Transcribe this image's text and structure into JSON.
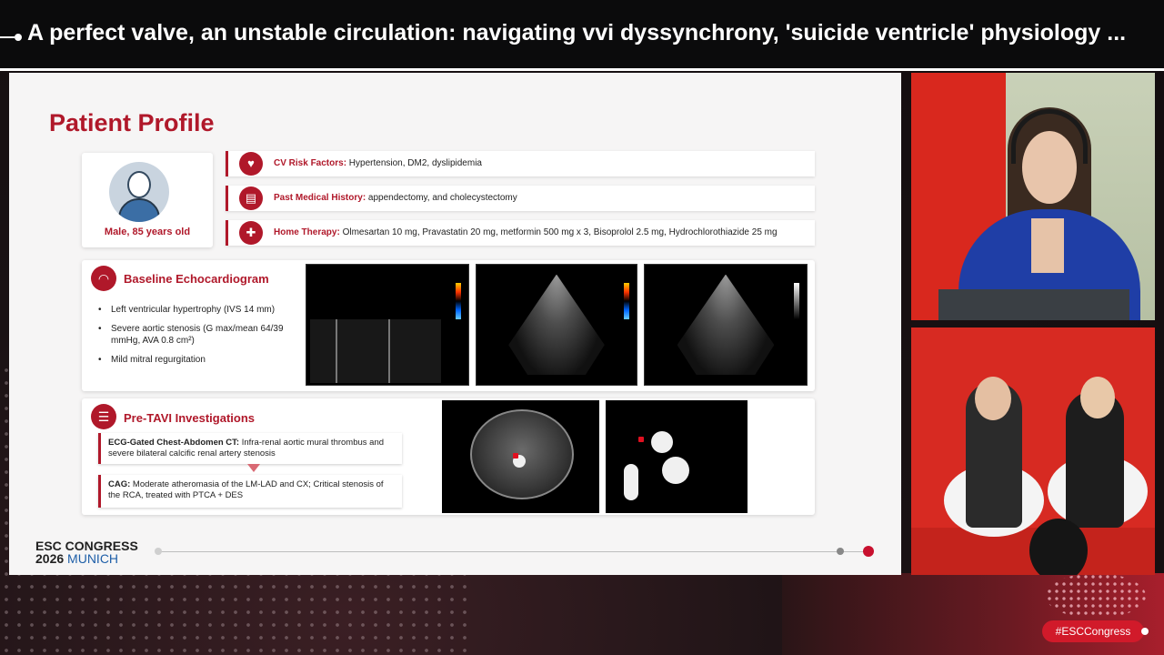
{
  "header": {
    "title": "A perfect valve, an unstable circulation: navigating vvi dyssynchrony, 'suicide ventricle' physiology ..."
  },
  "slide": {
    "title": "Patient Profile",
    "patient": {
      "label": "Male, 85 years old",
      "icon": "elderly-man-avatar"
    },
    "rows": [
      {
        "icon": "heart-pulse-icon",
        "label": "CV Risk Factors:",
        "value": " Hypertension, DM2, dyslipidemia"
      },
      {
        "icon": "clipboard-icon",
        "label": "Past Medical History:",
        "value": " appendectomy, and cholecystectomy"
      },
      {
        "icon": "pill-icon",
        "label": "Home Therapy:",
        "value": " Olmesartan 10 mg, Pravastatin 20 mg, metformin 500 mg x 3, Bisoprolol 2.5 mg, Hydrochlorothiazide 25 mg"
      }
    ],
    "echo": {
      "title": "Baseline Echocardiogram",
      "icon": "ultrasound-icon",
      "items": [
        "Left ventricular hypertrophy (IVS 14 mm)",
        "Severe aortic stenosis (G max/mean 64/39 mmHg, AVA 0.8 cm²)",
        "Mild mitral regurgitation"
      ]
    },
    "tavi": {
      "title": "Pre-TAVI Investigations",
      "icon": "clipboard-list-icon",
      "ct_label": "ECG-Gated Chest-Abdomen CT:",
      "ct_text": " Infra-renal aortic mural thrombus and severe bilateral calcific renal artery stenosis",
      "cag_label": "CAG:",
      "cag_text": " Moderate atheromasia of the LM-LAD and CX; Critical stenosis of the RCA, treated with PTCA + DES"
    },
    "footer": {
      "brand_line1": "ESC CONGRESS",
      "brand_year": "2026",
      "brand_city": "MUNICH"
    }
  },
  "hashtag": "#ESCCongress",
  "colors": {
    "accent": "#b0182a",
    "title_bar": "#0b0b0c"
  }
}
